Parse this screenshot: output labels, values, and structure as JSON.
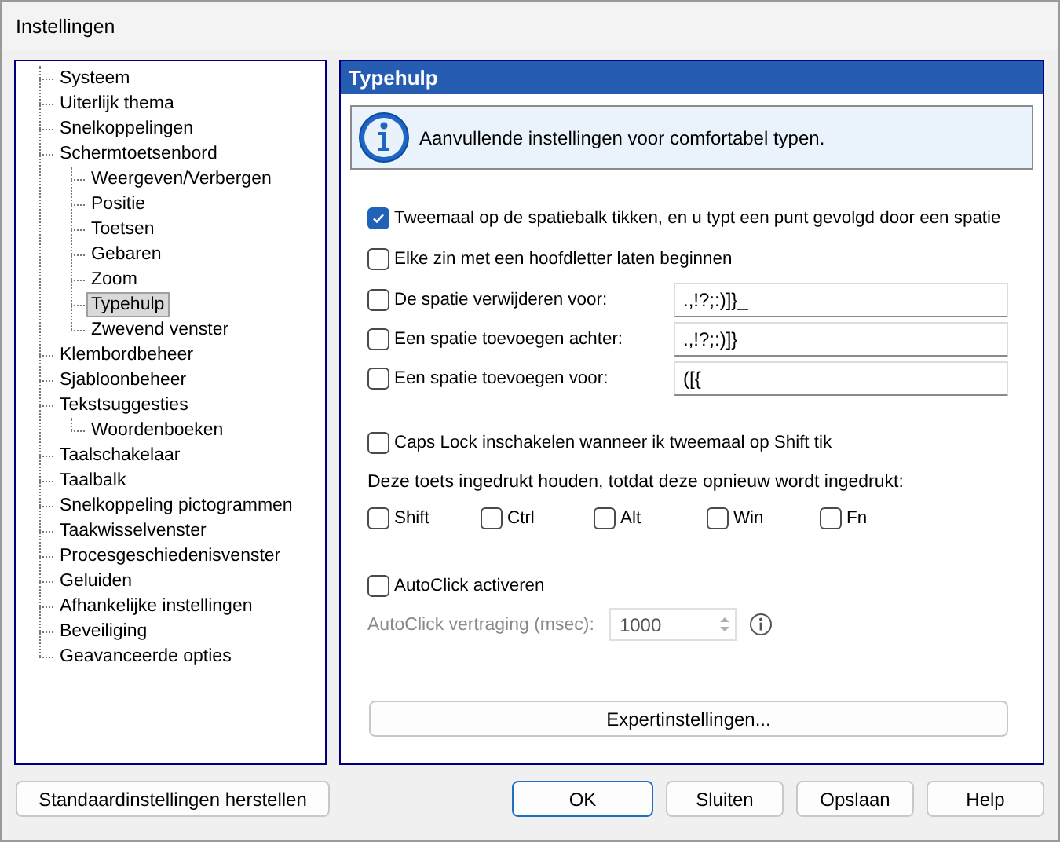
{
  "window": {
    "title": "Instellingen"
  },
  "tree": [
    {
      "label": "Systeem",
      "selected": false
    },
    {
      "label": "Uiterlijk thema",
      "selected": false
    },
    {
      "label": "Snelkoppelingen",
      "selected": false
    },
    {
      "label": "Schermtoetsenbord",
      "selected": false,
      "children": [
        {
          "label": "Weergeven/Verbergen",
          "selected": false
        },
        {
          "label": "Positie",
          "selected": false
        },
        {
          "label": "Toetsen",
          "selected": false
        },
        {
          "label": "Gebaren",
          "selected": false
        },
        {
          "label": "Zoom",
          "selected": false
        },
        {
          "label": "Typehulp",
          "selected": true
        },
        {
          "label": "Zwevend venster",
          "selected": false
        }
      ]
    },
    {
      "label": "Klembordbeheer",
      "selected": false
    },
    {
      "label": "Sjabloonbeheer",
      "selected": false
    },
    {
      "label": "Tekstsuggesties",
      "selected": false,
      "children": [
        {
          "label": "Woordenboeken",
          "selected": false
        }
      ]
    },
    {
      "label": "Taalschakelaar",
      "selected": false
    },
    {
      "label": "Taalbalk",
      "selected": false
    },
    {
      "label": "Snelkoppeling pictogrammen",
      "selected": false
    },
    {
      "label": "Taakwisselvenster",
      "selected": false
    },
    {
      "label": "Procesgeschiedenisvenster",
      "selected": false
    },
    {
      "label": "Geluiden",
      "selected": false
    },
    {
      "label": "Afhankelijke instellingen",
      "selected": false
    },
    {
      "label": "Beveiliging",
      "selected": false
    },
    {
      "label": "Geavanceerde opties",
      "selected": false
    }
  ],
  "panel": {
    "title": "Typehulp",
    "info": "Aanvullende instellingen voor comfortabel typen.",
    "options": [
      {
        "kind": "checkbox",
        "label": "Tweemaal op de spatiebalk tikken, en u typt een punt gevolgd door een spatie",
        "checked": true
      },
      {
        "kind": "checkbox",
        "label": "Elke zin met een hoofdletter laten beginnen",
        "checked": false
      },
      {
        "kind": "field",
        "label": "De spatie verwijderen voor:",
        "checked": false,
        "value": ".,!?;:)]}_"
      },
      {
        "kind": "field",
        "label": "Een spatie toevoegen achter:",
        "checked": false,
        "value": ".,!?;:)]}"
      },
      {
        "kind": "field",
        "label": "Een spatie toevoegen voor:",
        "checked": false,
        "value": "([{"
      }
    ],
    "caps_lock": {
      "label": "Caps Lock inschakelen wanneer ik tweemaal op Shift tik",
      "checked": false
    },
    "hold_label": "Deze toets ingedrukt houden, totdat deze opnieuw wordt ingedrukt:",
    "hold_keys": [
      {
        "label": "Shift",
        "checked": false
      },
      {
        "label": "Ctrl",
        "checked": false
      },
      {
        "label": "Alt",
        "checked": false
      },
      {
        "label": "Win",
        "checked": false
      },
      {
        "label": "Fn",
        "checked": false
      }
    ],
    "autoclick": {
      "label": "AutoClick activeren",
      "checked": false
    },
    "delay": {
      "label": "AutoClick vertraging (msec):",
      "value": "1000",
      "disabled": true
    },
    "expert_button": "Expertinstellingen..."
  },
  "buttons": [
    {
      "label": "Standaardinstellingen herstellen",
      "default": false
    },
    {
      "label": "OK",
      "default": true
    },
    {
      "label": "Sluiten",
      "default": false
    },
    {
      "label": "Opslaan",
      "default": false
    },
    {
      "label": "Help",
      "default": false
    }
  ]
}
